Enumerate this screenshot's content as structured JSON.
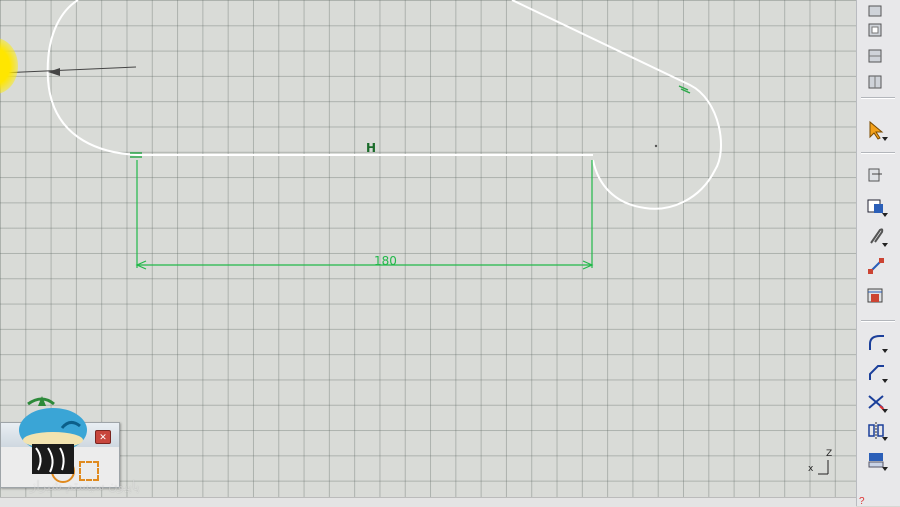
{
  "sketch": {
    "dimension_value": "180",
    "horizontal_constraint": "H",
    "line_color": "#ffffff",
    "dimension_color": "#22b84a",
    "constraint_color": "#1a6b2a",
    "grid_color": "#5a645f"
  },
  "axis": {
    "x_label": "x",
    "z_label": "Z"
  },
  "mini_panel": {
    "close_label": "✕"
  },
  "watermark": {
    "text": "پاپیون سیستم شیراز"
  },
  "toolbar": {
    "buttons": [
      {
        "name": "toolbar-button-1-icon"
      },
      {
        "name": "toolbar-button-2-icon"
      },
      {
        "name": "toolbar-button-3-icon"
      },
      {
        "name": "toolbar-button-4-icon"
      },
      {
        "name": "select-arrow-icon"
      },
      {
        "name": "sketcher-icon"
      },
      {
        "name": "profile-icon"
      },
      {
        "name": "snap-icon"
      },
      {
        "name": "constraint-icon"
      },
      {
        "name": "analysis-icon"
      },
      {
        "name": "corner-icon"
      },
      {
        "name": "chamfer-icon"
      },
      {
        "name": "trim-icon"
      },
      {
        "name": "mirror-icon"
      },
      {
        "name": "project-3d-icon"
      }
    ]
  }
}
